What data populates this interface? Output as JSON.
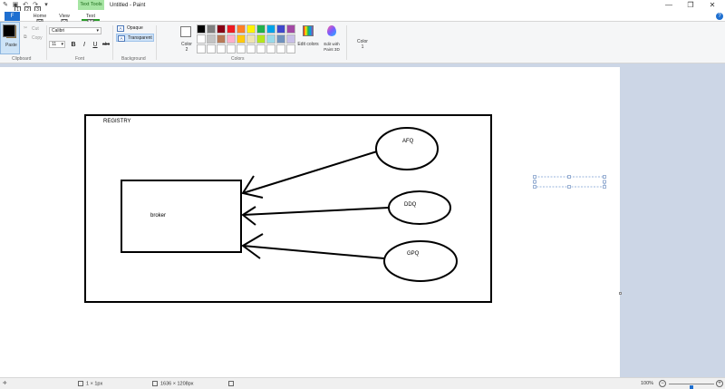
{
  "titlebar": {
    "context_tab": "Text Tools",
    "title": "Untitled - Paint",
    "quick_access_icons": [
      "paint-app-icon",
      "save-icon",
      "undo-icon",
      "redo-icon",
      "customize-icon"
    ],
    "key_tips": [
      "1",
      "2",
      "3"
    ],
    "minimize": "—",
    "maximize": "❐",
    "close": "✕"
  },
  "tabs": {
    "file": {
      "label": "F",
      "key_tip": ""
    },
    "home": {
      "label": "Home",
      "key_tip": "H"
    },
    "view": {
      "label": "View",
      "key_tip": "V"
    },
    "text": {
      "label": "Text",
      "key_tip": "T"
    }
  },
  "ribbon": {
    "clipboard": {
      "label": "Clipboard",
      "paste": "Paste",
      "cut": "Cut",
      "copy": "Copy"
    },
    "font": {
      "label": "Font",
      "family": "Calibri",
      "size": "11",
      "bold": "B",
      "italic": "I",
      "underline": "U",
      "strikethrough": "abc"
    },
    "background": {
      "label": "Background",
      "opaque": "Opaque",
      "transparent": "Transparent",
      "selected": "Transparent"
    },
    "colors": {
      "label": "Colors",
      "color1_label": "Color",
      "color1_num": "1",
      "color2_label": "Color",
      "color2_num": "2",
      "color1_value": "#000000",
      "color2_value": "#ffffff",
      "palette_row1": [
        "#000000",
        "#7f7f7f",
        "#880015",
        "#ed1c24",
        "#ff7f27",
        "#fff200",
        "#22b14c",
        "#00a2e8",
        "#3f48cc",
        "#a349a4"
      ],
      "palette_row2": [
        "#ffffff",
        "#c3c3c3",
        "#b97a57",
        "#ffaec9",
        "#ffc90e",
        "#efe4b0",
        "#b5e61d",
        "#99d9ea",
        "#7092be",
        "#c8bfe7"
      ],
      "palette_row3": [
        "#ffffff",
        "#ffffff",
        "#ffffff",
        "#ffffff",
        "#ffffff",
        "#ffffff",
        "#ffffff",
        "#ffffff",
        "#ffffff",
        "#ffffff"
      ],
      "edit_colors": "Edit colors",
      "edit_paint3d": "Edit with Paint 3D"
    }
  },
  "drawing": {
    "registry_label": "REGISTRY",
    "broker_label": "broker",
    "nodes": [
      "AFQ",
      "DDQ",
      "GPQ"
    ]
  },
  "statusbar": {
    "selection_size": "1 × 1px",
    "image_size": "1636 × 1208px",
    "zoom": "100%",
    "zoom_fraction": 0.5
  }
}
